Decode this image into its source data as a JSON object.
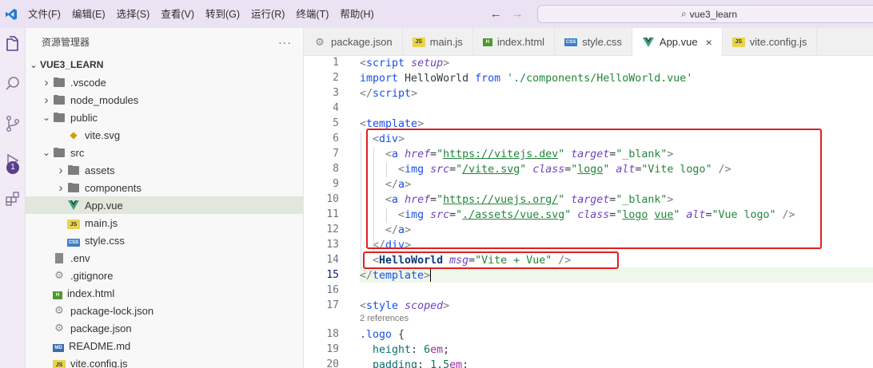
{
  "menu": [
    "文件(F)",
    "编辑(E)",
    "选择(S)",
    "查看(V)",
    "转到(G)",
    "运行(R)",
    "终端(T)",
    "帮助(H)"
  ],
  "search": {
    "text": "vue3_learn"
  },
  "activity": {
    "debug_badge": "1"
  },
  "explorer": {
    "title": "资源管理器",
    "more": "···",
    "root": "VUE3_LEARN",
    "items": [
      {
        "label": ".vscode",
        "kind": "folder",
        "expanded": false,
        "depth": 1
      },
      {
        "label": "node_modules",
        "kind": "folder",
        "expanded": false,
        "depth": 1
      },
      {
        "label": "public",
        "kind": "folder",
        "expanded": true,
        "depth": 1
      },
      {
        "label": "vite.svg",
        "kind": "svg",
        "depth": 2
      },
      {
        "label": "src",
        "kind": "folder",
        "expanded": true,
        "depth": 1
      },
      {
        "label": "assets",
        "kind": "folder",
        "expanded": false,
        "depth": 2
      },
      {
        "label": "components",
        "kind": "folder",
        "expanded": false,
        "depth": 2
      },
      {
        "label": "App.vue",
        "kind": "vue",
        "depth": 2,
        "selected": true
      },
      {
        "label": "main.js",
        "kind": "js",
        "depth": 2
      },
      {
        "label": "style.css",
        "kind": "css",
        "depth": 2
      },
      {
        "label": ".env",
        "kind": "doc",
        "depth": 1
      },
      {
        "label": ".gitignore",
        "kind": "gear",
        "depth": 1
      },
      {
        "label": "index.html",
        "kind": "html",
        "depth": 1
      },
      {
        "label": "package-lock.json",
        "kind": "gear",
        "depth": 1
      },
      {
        "label": "package.json",
        "kind": "gear",
        "depth": 1
      },
      {
        "label": "README.md",
        "kind": "md",
        "depth": 1
      },
      {
        "label": "vite.config.js",
        "kind": "js",
        "depth": 1
      }
    ]
  },
  "tabs": [
    {
      "label": "package.json",
      "kind": "gear",
      "active": false
    },
    {
      "label": "main.js",
      "kind": "js",
      "active": false
    },
    {
      "label": "index.html",
      "kind": "html",
      "active": false
    },
    {
      "label": "style.css",
      "kind": "css",
      "active": false
    },
    {
      "label": "App.vue",
      "kind": "vue",
      "active": true,
      "close": "×"
    },
    {
      "label": "vite.config.js",
      "kind": "js",
      "active": false
    }
  ],
  "icon_labels": {
    "js": "JS",
    "css": "CSS",
    "html": "H",
    "md": "MD"
  },
  "editor": {
    "line_numbers": [
      "1",
      "2",
      "3",
      "4",
      "5",
      "6",
      "7",
      "8",
      "9",
      "10",
      "11",
      "12",
      "13",
      "14",
      "15",
      "16",
      "17",
      "18",
      "19",
      "20"
    ],
    "current_line": "15",
    "codelens": "2 references",
    "lines": [
      [
        [
          "t-punc",
          "<"
        ],
        [
          "t-tag",
          "script "
        ],
        [
          "t-attr",
          "setup"
        ],
        [
          "t-punc",
          ">"
        ]
      ],
      [
        [
          "t-kw",
          "import "
        ],
        [
          "",
          "HelloWorld "
        ],
        [
          "t-kw",
          "from "
        ],
        [
          "t-str",
          "'./components/HelloWorld.vue'"
        ]
      ],
      [
        [
          "t-punc",
          "</"
        ],
        [
          "t-tag",
          "script"
        ],
        [
          "t-punc",
          ">"
        ]
      ],
      [],
      [
        [
          "t-punc",
          "<"
        ],
        [
          "t-tpl",
          "template"
        ],
        [
          "t-punc",
          ">"
        ]
      ],
      [
        [
          "",
          "  "
        ],
        [
          "t-punc",
          "<"
        ],
        [
          "t-tag",
          "div"
        ],
        [
          "t-punc",
          ">"
        ]
      ],
      [
        [
          "",
          "    "
        ],
        [
          "t-punc",
          "<"
        ],
        [
          "t-tag",
          "a "
        ],
        [
          "t-attr",
          "href"
        ],
        [
          "",
          "="
        ],
        [
          "t-str",
          "\""
        ],
        [
          "t-url",
          "https://vitejs.dev"
        ],
        [
          "t-str",
          "\" "
        ],
        [
          "t-attr",
          "target"
        ],
        [
          "",
          "="
        ],
        [
          "t-str",
          "\"_blank\""
        ],
        [
          "t-punc",
          ">"
        ]
      ],
      [
        [
          "",
          "      "
        ],
        [
          "t-punc",
          "<"
        ],
        [
          "t-tag",
          "img "
        ],
        [
          "t-attr",
          "src"
        ],
        [
          "",
          "="
        ],
        [
          "t-str",
          "\""
        ],
        [
          "t-url",
          "/vite.svg"
        ],
        [
          "t-str",
          "\" "
        ],
        [
          "t-attr",
          "class"
        ],
        [
          "",
          "="
        ],
        [
          "t-str",
          "\""
        ],
        [
          "t-url",
          "logo"
        ],
        [
          "t-str",
          "\" "
        ],
        [
          "t-attr",
          "alt"
        ],
        [
          "",
          "="
        ],
        [
          "t-str",
          "\"Vite logo\" "
        ],
        [
          "t-punc",
          "/>"
        ]
      ],
      [
        [
          "",
          "    "
        ],
        [
          "t-punc",
          "</"
        ],
        [
          "t-tag",
          "a"
        ],
        [
          "t-punc",
          ">"
        ]
      ],
      [
        [
          "",
          "    "
        ],
        [
          "t-punc",
          "<"
        ],
        [
          "t-tag",
          "a "
        ],
        [
          "t-attr",
          "href"
        ],
        [
          "",
          "="
        ],
        [
          "t-str",
          "\""
        ],
        [
          "t-url",
          "https://vuejs.org/"
        ],
        [
          "t-str",
          "\" "
        ],
        [
          "t-attr",
          "target"
        ],
        [
          "",
          "="
        ],
        [
          "t-str",
          "\"_blank\""
        ],
        [
          "t-punc",
          ">"
        ]
      ],
      [
        [
          "",
          "      "
        ],
        [
          "t-punc",
          "<"
        ],
        [
          "t-tag",
          "img "
        ],
        [
          "t-attr",
          "src"
        ],
        [
          "",
          "="
        ],
        [
          "t-str",
          "\""
        ],
        [
          "t-url",
          "./assets/vue.svg"
        ],
        [
          "t-str",
          "\" "
        ],
        [
          "t-attr",
          "class"
        ],
        [
          "",
          "="
        ],
        [
          "t-str",
          "\""
        ],
        [
          "t-url",
          "logo"
        ],
        [
          "t-str",
          " "
        ],
        [
          "t-url",
          "vue"
        ],
        [
          "t-str",
          "\" "
        ],
        [
          "t-attr",
          "alt"
        ],
        [
          "",
          "="
        ],
        [
          "t-str",
          "\"Vue logo\" "
        ],
        [
          "t-punc",
          "/>"
        ]
      ],
      [
        [
          "",
          "    "
        ],
        [
          "t-punc",
          "</"
        ],
        [
          "t-tag",
          "a"
        ],
        [
          "t-punc",
          ">"
        ]
      ],
      [
        [
          "",
          "  "
        ],
        [
          "t-punc",
          "</"
        ],
        [
          "t-tag",
          "div"
        ],
        [
          "t-punc",
          ">"
        ]
      ],
      [
        [
          "",
          "  "
        ],
        [
          "t-punc",
          "<"
        ],
        [
          "t-comp",
          "HelloWorld "
        ],
        [
          "t-attr",
          "msg"
        ],
        [
          "",
          "="
        ],
        [
          "t-str",
          "\"Vite + Vue\" "
        ],
        [
          "t-punc",
          "/>"
        ]
      ],
      [
        [
          "t-punc",
          "</"
        ],
        [
          "t-tpl",
          "template"
        ],
        [
          "t-punc",
          ">"
        ]
      ],
      [],
      [
        [
          "t-punc",
          "<"
        ],
        [
          "t-tag",
          "style "
        ],
        [
          "t-attr",
          "scoped"
        ],
        [
          "t-punc",
          ">"
        ]
      ],
      [
        [
          "t-sel",
          ".logo "
        ],
        [
          "",
          "{"
        ]
      ],
      [
        [
          "",
          "  "
        ],
        [
          "t-prop",
          "height"
        ],
        [
          "",
          ": "
        ],
        [
          "t-num",
          "6"
        ],
        [
          "t-unit",
          "em"
        ],
        [
          "",
          ";"
        ]
      ],
      [
        [
          "",
          "  "
        ],
        [
          "t-prop",
          "padding"
        ],
        [
          "",
          ": "
        ],
        [
          "t-num",
          "1.5"
        ],
        [
          "t-unit",
          "em"
        ],
        [
          "",
          ";"
        ]
      ]
    ]
  }
}
